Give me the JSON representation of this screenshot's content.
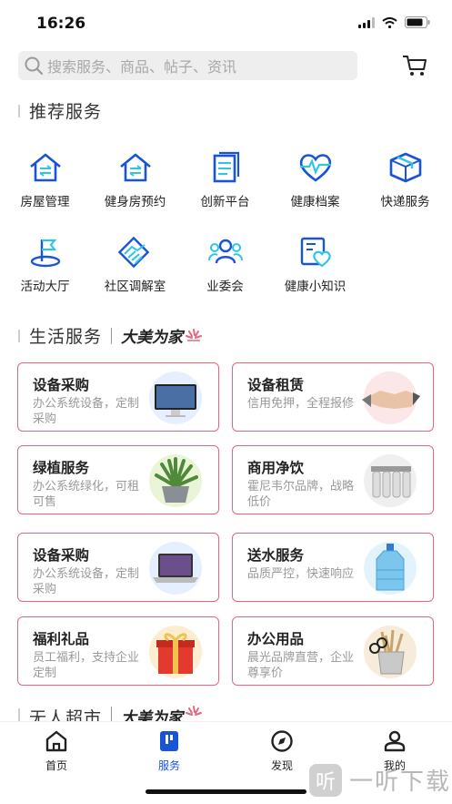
{
  "status": {
    "time": "16:26"
  },
  "search": {
    "placeholder": "搜索服务、商品、帖子、资讯"
  },
  "recommend": {
    "title": "推荐服务",
    "items": [
      {
        "label": "房屋管理",
        "icon": "house-icon"
      },
      {
        "label": "健身房预约",
        "icon": "gym-house-icon"
      },
      {
        "label": "创新平台",
        "icon": "document-stack-icon"
      },
      {
        "label": "健康档案",
        "icon": "heart-pulse-icon"
      },
      {
        "label": "快递服务",
        "icon": "parcel-box-icon"
      },
      {
        "label": "活动大厅",
        "icon": "flag-icon"
      },
      {
        "label": "社区调解室",
        "icon": "handshake-icon"
      },
      {
        "label": "业委会",
        "icon": "group-icon"
      },
      {
        "label": "健康小知识",
        "icon": "health-tips-icon"
      }
    ]
  },
  "life": {
    "title": "生活服务",
    "brand": "大美为家",
    "cards": [
      {
        "title": "设备采购",
        "desc": "办公系统设备，定制采购",
        "image": "monitor-image"
      },
      {
        "title": "设备租赁",
        "desc": "信用免押，全程报修",
        "image": "handshake-image"
      },
      {
        "title": "绿植服务",
        "desc": "办公系统绿化，可租可售",
        "image": "plant-image"
      },
      {
        "title": "商用净饮",
        "desc": "霍尼韦尔品牌，战略低价",
        "image": "water-purifier-image"
      },
      {
        "title": "设备采购",
        "desc": "办公系统设备，定制采购",
        "image": "laptop-image"
      },
      {
        "title": "送水服务",
        "desc": "品质严控，快速响应",
        "image": "water-bottle-image"
      },
      {
        "title": "福利礼品",
        "desc": "员工福利，支持企业定制",
        "image": "gift-box-image"
      },
      {
        "title": "办公用品",
        "desc": "晨光品牌直营，企业尊享价",
        "image": "stationery-image"
      }
    ]
  },
  "market": {
    "title": "无人超市",
    "brand": "大美为家"
  },
  "tabs": [
    {
      "label": "首页",
      "icon": "home-icon",
      "active": false
    },
    {
      "label": "服务",
      "icon": "service-icon",
      "active": true
    },
    {
      "label": "发现",
      "icon": "compass-icon",
      "active": false
    },
    {
      "label": "我的",
      "icon": "profile-icon",
      "active": false
    }
  ],
  "watermark": {
    "badge": "听",
    "text": "一听下载"
  },
  "colors": {
    "accent": "#1a54d6",
    "card_border": "#e5667f",
    "icon_cyan": "#2ec5e6"
  }
}
